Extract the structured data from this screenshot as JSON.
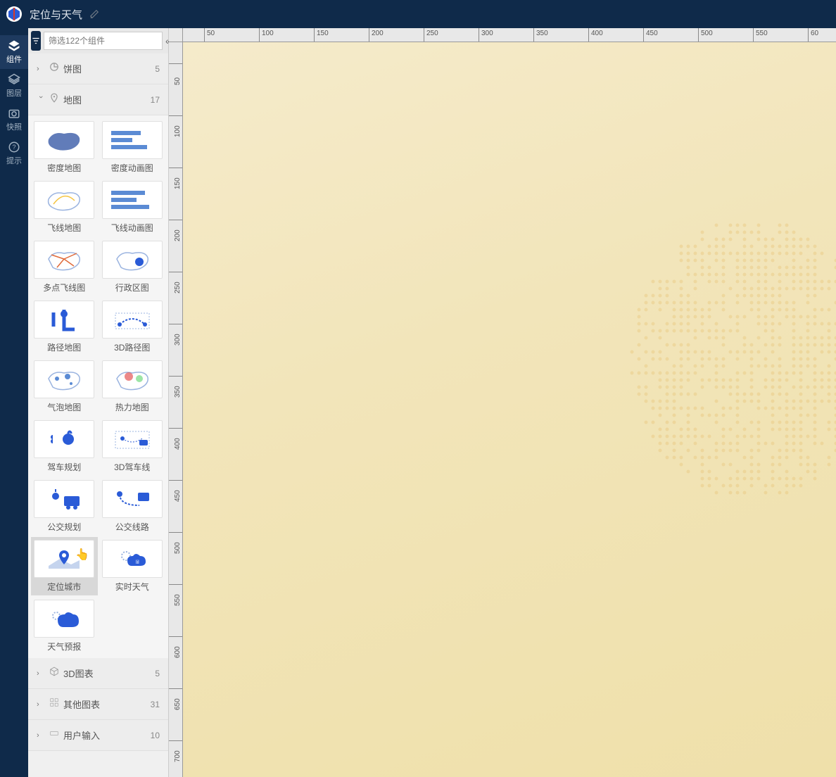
{
  "header": {
    "title": "定位与天气"
  },
  "navrail": {
    "items": [
      {
        "label": "组件"
      },
      {
        "label": "图层"
      },
      {
        "label": "快照"
      },
      {
        "label": "提示"
      }
    ]
  },
  "search": {
    "placeholder": "筛选122个组件"
  },
  "categories": {
    "pie": {
      "label": "饼图",
      "count": "5"
    },
    "map": {
      "label": "地图",
      "count": "17"
    },
    "chart3d": {
      "label": "3D图表",
      "count": "5"
    },
    "other": {
      "label": "其他图表",
      "count": "31"
    },
    "input": {
      "label": "用户输入",
      "count": "10"
    }
  },
  "map_components": [
    {
      "label": "密度地图"
    },
    {
      "label": "密度动画图"
    },
    {
      "label": "飞线地图"
    },
    {
      "label": "飞线动画图"
    },
    {
      "label": "多点飞线图"
    },
    {
      "label": "行政区图"
    },
    {
      "label": "路径地图"
    },
    {
      "label": "3D路径图"
    },
    {
      "label": "气泡地图"
    },
    {
      "label": "热力地图"
    },
    {
      "label": "驾车规划"
    },
    {
      "label": "3D驾车线"
    },
    {
      "label": "公交规划"
    },
    {
      "label": "公交线路"
    },
    {
      "label": "定位城市"
    },
    {
      "label": "实时天气"
    },
    {
      "label": "天气预报"
    }
  ],
  "ruler": {
    "h_ticks": [
      "50",
      "100",
      "150",
      "200",
      "250",
      "300",
      "350",
      "400",
      "450",
      "500",
      "550",
      "60"
    ],
    "v_ticks": [
      "50",
      "100",
      "150",
      "200",
      "250",
      "300",
      "350",
      "400",
      "450",
      "500",
      "550",
      "600",
      "650",
      "700"
    ]
  }
}
